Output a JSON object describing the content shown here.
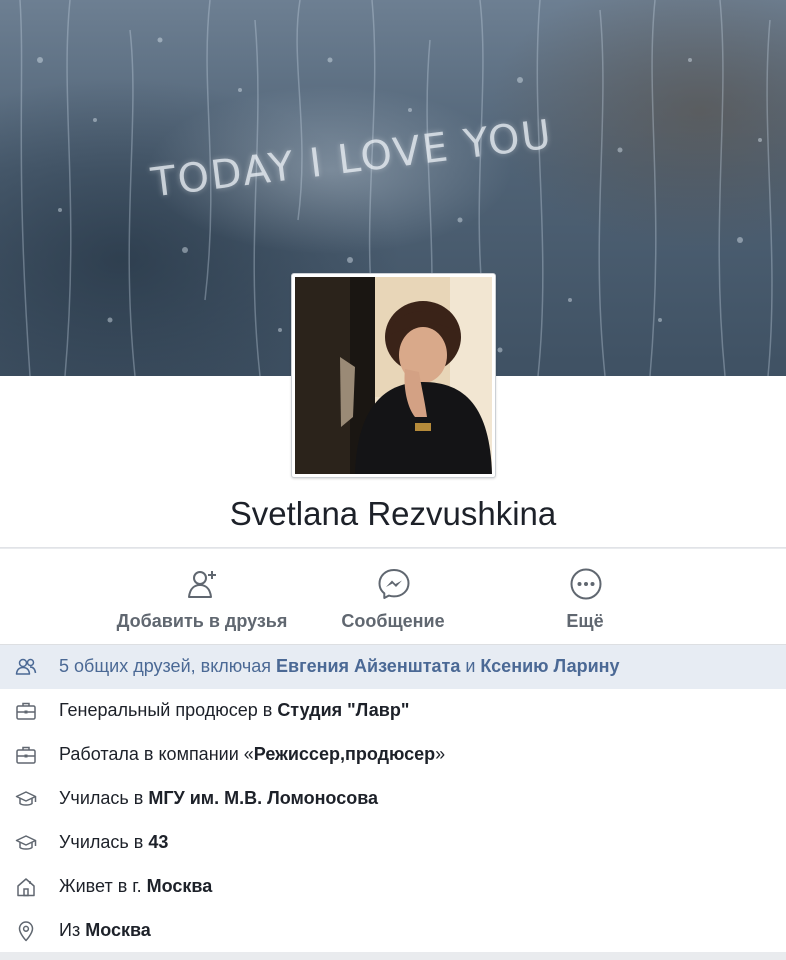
{
  "cover": {
    "text": "TODAY I LOVE YOU"
  },
  "profile": {
    "name": "Svetlana Rezvushkina"
  },
  "actions": [
    {
      "label": "Добавить в друзья",
      "icon": "add-friend-icon"
    },
    {
      "label": "Сообщение",
      "icon": "messenger-icon"
    },
    {
      "label": "Ещё",
      "icon": "more-icon"
    }
  ],
  "info": {
    "mutual_friends": {
      "prefix": "5 общих друзей, включая ",
      "friend1": "Евгения Айзенштата",
      "and": " и ",
      "friend2": "Ксению Ларину",
      "icon": "friends-icon"
    },
    "job": {
      "prefix": "Генеральный продюсер в ",
      "place": "Студия \"Лавр\"",
      "icon": "briefcase-icon"
    },
    "past_job": {
      "prefix": "Работала в компании «",
      "place": "Режиссер,продюсер",
      "suffix": "»",
      "icon": "briefcase-icon"
    },
    "education1": {
      "prefix": "Училась в ",
      "place": "МГУ им. М.В. Ломоносова",
      "icon": "graduation-cap-icon"
    },
    "education2": {
      "prefix": "Училась в ",
      "place": "43",
      "icon": "graduation-cap-icon"
    },
    "lives": {
      "prefix": "Живет в г. ",
      "place": "Москва",
      "icon": "home-icon"
    },
    "from": {
      "prefix": "Из ",
      "place": "Москва",
      "icon": "location-pin-icon"
    }
  },
  "colors": {
    "highlight_bg": "#e7ecf3",
    "link_blue": "#4b6995",
    "action_gray": "#606770"
  }
}
